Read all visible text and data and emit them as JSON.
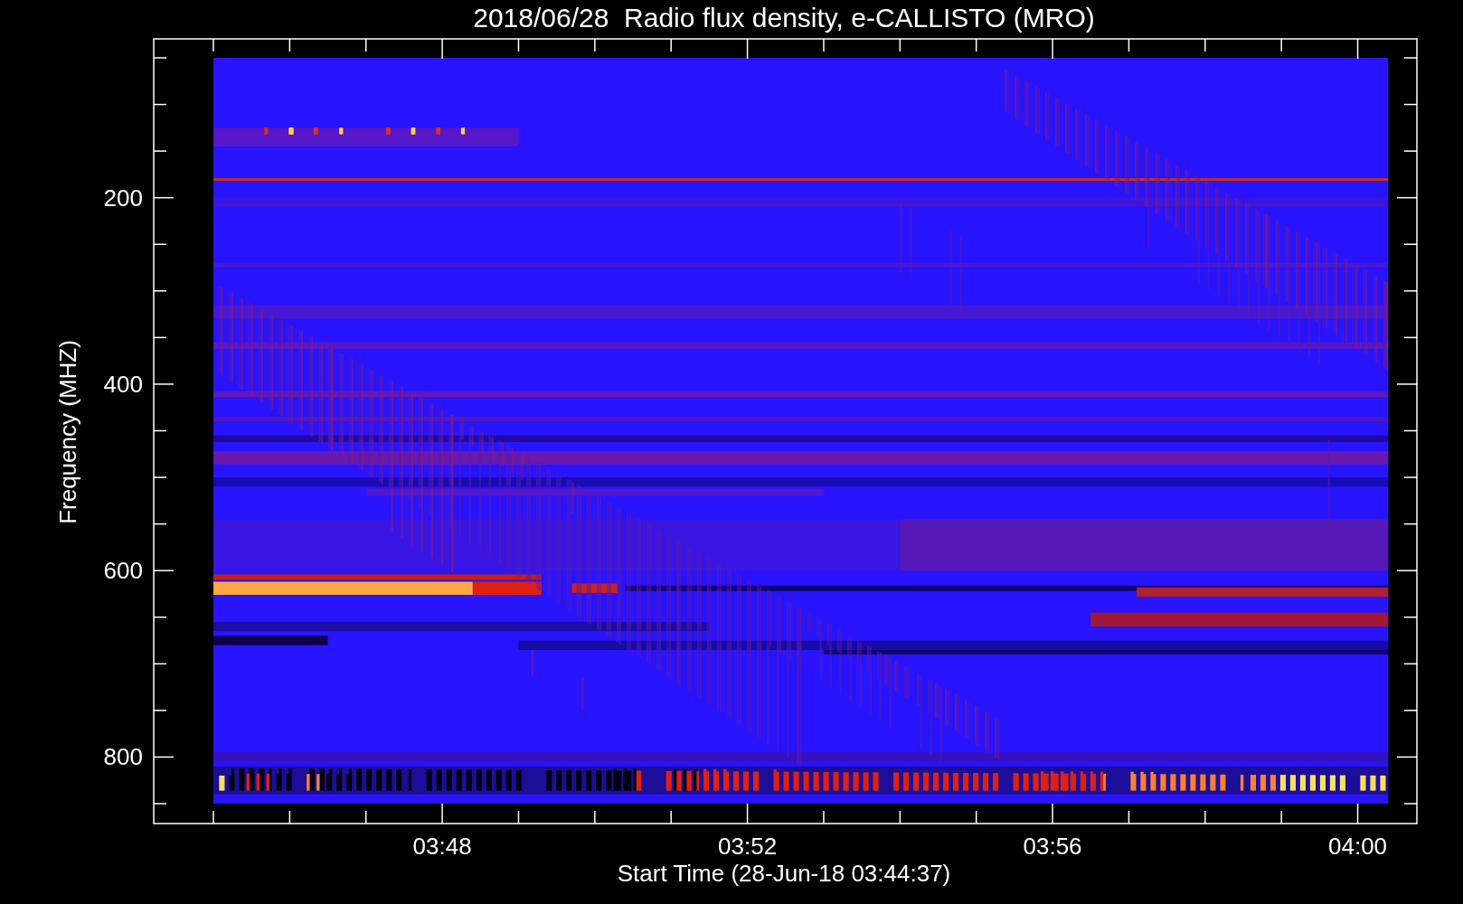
{
  "title": "2018/06/28  Radio flux density, e-CALLISTO (MRO)",
  "y_axis": {
    "label": "Frequency (MHZ)",
    "ticks": [
      "200",
      "400",
      "600",
      "800"
    ]
  },
  "x_axis": {
    "label": "Start Time (28-Jun-18 03:44:37)",
    "ticks": [
      "03:48",
      "03:52",
      "03:56",
      "04:00"
    ]
  }
}
